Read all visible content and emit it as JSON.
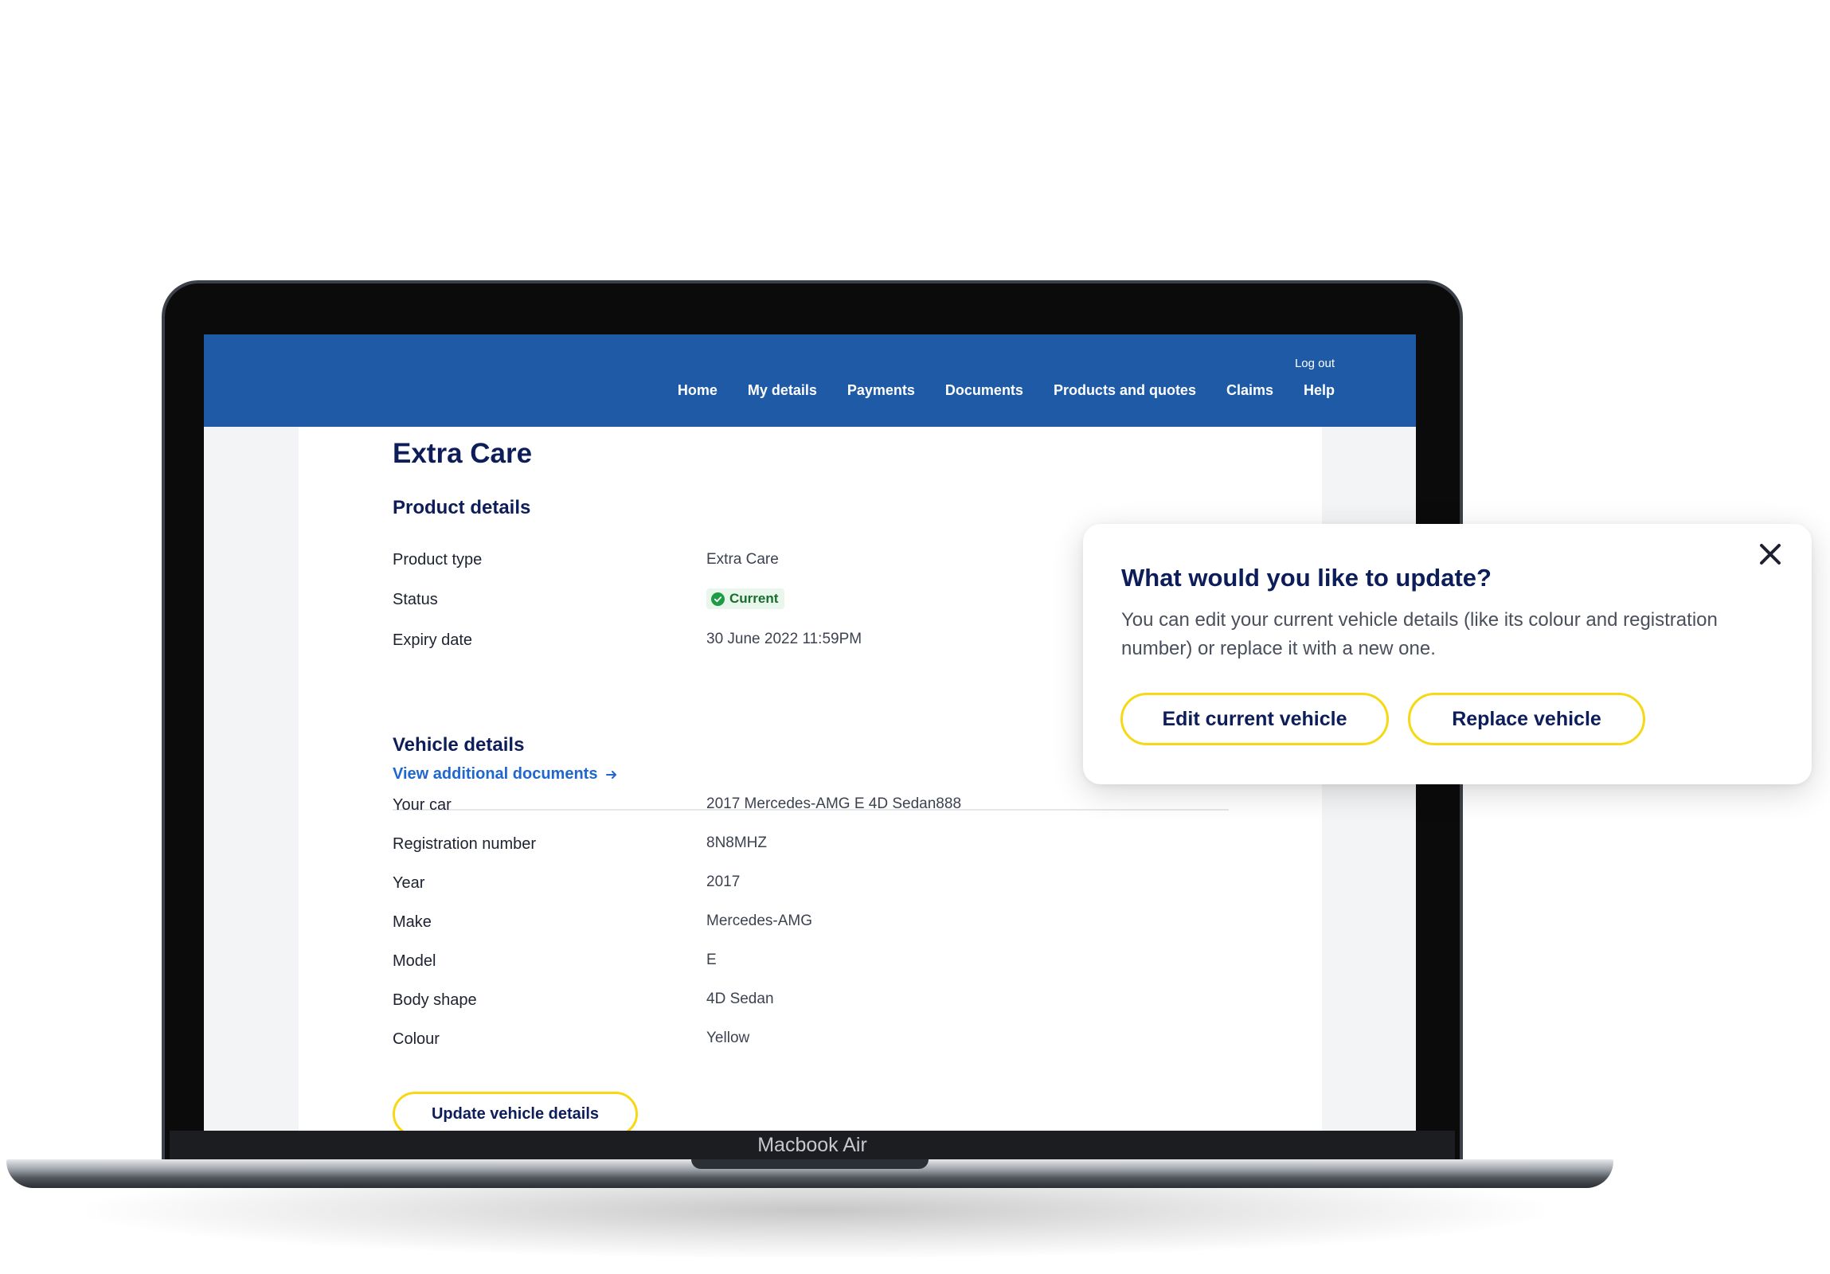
{
  "header": {
    "logout_label": "Log out",
    "nav": [
      "Home",
      "My details",
      "Payments",
      "Documents",
      "Products and quotes",
      "Claims",
      "Help"
    ]
  },
  "page": {
    "title": "Extra Care",
    "product_section": {
      "title": "Product details",
      "rows": [
        {
          "label": "Product type",
          "value": "Extra Care"
        },
        {
          "label": "Status",
          "value": "Current"
        },
        {
          "label": "Expiry date",
          "value": "30 June 2022 11:59PM"
        }
      ],
      "docs_link": "View additional documents"
    },
    "vehicle_section": {
      "title": "Vehicle details",
      "rows": [
        {
          "label": "Your car",
          "value": "2017 Mercedes-AMG E 4D Sedan888"
        },
        {
          "label": "Registration number",
          "value": "8N8MHZ"
        },
        {
          "label": "Year",
          "value": "2017"
        },
        {
          "label": "Make",
          "value": "Mercedes-AMG"
        },
        {
          "label": "Model",
          "value": "E"
        },
        {
          "label": "Body shape",
          "value": "4D Sedan"
        },
        {
          "label": "Colour",
          "value": "Yellow"
        }
      ],
      "update_button": "Update vehicle details"
    }
  },
  "device_label": "Macbook Air",
  "modal": {
    "title": "What would you like to update?",
    "description": "You can edit your current vehicle details (like its colour and registration number) or replace it with a new one.",
    "edit_button": "Edit current vehicle",
    "replace_button": "Replace vehicle"
  },
  "colors": {
    "header_blue": "#1e5aa6",
    "navy_text": "#0c1d5a",
    "accent_yellow": "#f6d814",
    "link_blue": "#1f66d1",
    "status_green": "#1d9b45"
  }
}
